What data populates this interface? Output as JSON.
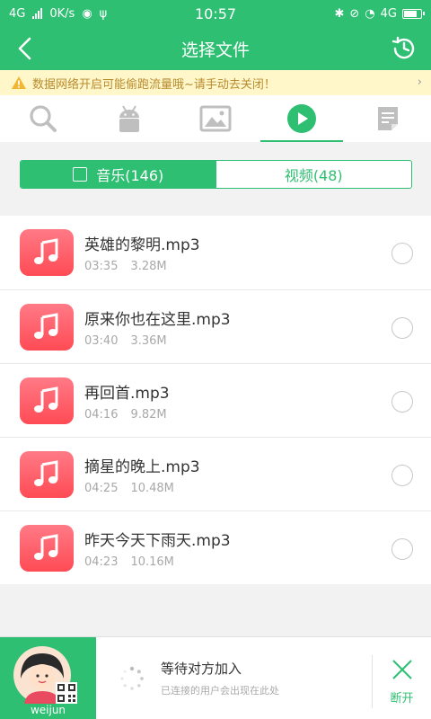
{
  "status_bar": {
    "network": "4G",
    "speed": "0K/s",
    "time": "10:57",
    "network_right": "4G"
  },
  "header": {
    "title": "选择文件",
    "back_icon": "arrow-left-icon",
    "history_icon": "history-clock-icon"
  },
  "warning": {
    "text": "数据网络开启可能偷跑流量哦~请手动去关闭！",
    "arrow": "›"
  },
  "category_tabs": [
    {
      "icon": "search-icon",
      "active": false
    },
    {
      "icon": "android-icon",
      "active": false
    },
    {
      "icon": "image-icon",
      "active": false
    },
    {
      "icon": "play-icon",
      "active": true
    },
    {
      "icon": "document-icon",
      "active": false
    }
  ],
  "segmented": {
    "music": "音乐(146)",
    "video": "视频(48)"
  },
  "files": [
    {
      "name": "英雄的黎明.mp3",
      "duration": "03:35",
      "size": "3.28M"
    },
    {
      "name": "原来你也在这里.mp3",
      "duration": "03:40",
      "size": "3.36M"
    },
    {
      "name": "再回首.mp3",
      "duration": "04:16",
      "size": "9.82M"
    },
    {
      "name": "摘星的晚上.mp3",
      "duration": "04:25",
      "size": "10.48M"
    },
    {
      "name": "昨天今天下雨天.mp3",
      "duration": "04:23",
      "size": "10.16M"
    }
  ],
  "bottom": {
    "username": "weijun",
    "wait_title": "等待对方加入",
    "wait_sub": "已连接的用户会出现在此处",
    "disconnect": "断开"
  },
  "colors": {
    "accent": "#2fbf72",
    "music_icon": "#ff5a64",
    "warning_bg": "#fff7c9"
  }
}
